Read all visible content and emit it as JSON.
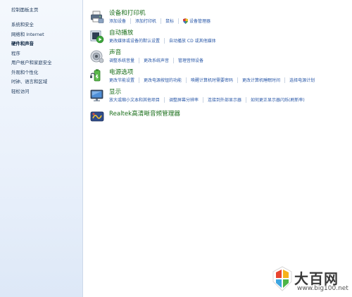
{
  "sidebar": {
    "home": "控制面板主页",
    "items": [
      {
        "label": "系统和安全",
        "active": false
      },
      {
        "label": "网络和 Internet",
        "active": false
      },
      {
        "label": "硬件和声音",
        "active": true
      },
      {
        "label": "程序",
        "active": false
      },
      {
        "label": "用户帐户和家庭安全",
        "active": false
      },
      {
        "label": "外观和个性化",
        "active": false
      },
      {
        "label": "时钟、语言和区域",
        "active": false
      },
      {
        "label": "轻松访问",
        "active": false
      }
    ]
  },
  "categories": [
    {
      "title": "设备和打印机",
      "icon": "printer-icon",
      "links": [
        "添加设备",
        "添加打印机",
        "鼠标",
        "设备管理器"
      ]
    },
    {
      "title": "自动播放",
      "icon": "autoplay-icon",
      "links": [
        "更改媒体或设备的默认设置",
        "自动播放 CD 或其他媒体"
      ]
    },
    {
      "title": "声音",
      "icon": "speaker-icon",
      "links": [
        "调整系统音量",
        "更改系统声音",
        "管理音频设备"
      ]
    },
    {
      "title": "电源选项",
      "icon": "power-icon",
      "links": [
        "更改节能设置",
        "更改电源按钮的功能",
        "唤醒计算机时需要密码",
        "更改计算机睡眠时间",
        "选择电源计划"
      ]
    },
    {
      "title": "显示",
      "icon": "display-icon",
      "links": [
        "放大或缩小文本和其他项目",
        "调整屏幕分辨率",
        "连接到外部显示器",
        "如何更正显示器闪烁(刷新率)"
      ]
    },
    {
      "title": "Realtek高清晰音频管理器",
      "icon": "realtek-icon",
      "links": []
    }
  ],
  "watermark": {
    "text": "大百网",
    "url": "www.big100.net"
  },
  "colors": {
    "category_title": "#1a6e1a",
    "link": "#2a58a8",
    "sidebar_text": "#1e395b"
  }
}
